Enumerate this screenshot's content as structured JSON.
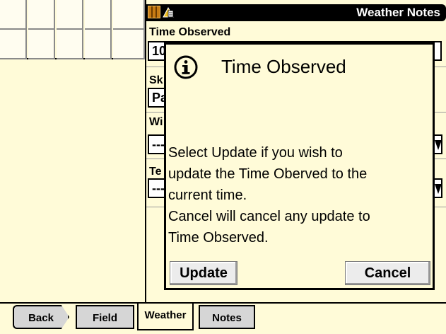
{
  "window": {
    "title": "Weather Notes"
  },
  "form": {
    "time_observed_label": "Time Observed",
    "time_observed_value": "10",
    "sky_label": "Sk",
    "sky_value": "Pa",
    "wind_label": "Wi",
    "wind_value": "---",
    "temp_label": "Te",
    "temp_value": "---"
  },
  "dialog": {
    "title": "Time Observed",
    "message_lines": [
      "Select Update if you wish to",
      "update the Time Oberved to the",
      "current time.",
      "Cancel will cancel any update to",
      "Time Observed."
    ],
    "update_label": "Update",
    "cancel_label": "Cancel"
  },
  "tabs": [
    {
      "label": "Back",
      "state": "inactive"
    },
    {
      "label": "Field",
      "state": "inactive"
    },
    {
      "label": "Weather",
      "state": "active"
    },
    {
      "label": "Notes",
      "state": "inactive"
    }
  ],
  "icons": {
    "titlebar_left": "field-map-icon",
    "titlebar_right": "weather-notes-icon",
    "dialog": "info-icon"
  },
  "colors": {
    "background": "#fffbd8",
    "titlebar": "#000000",
    "tab_inactive": "#d6d6d6",
    "button": "#ececec"
  }
}
